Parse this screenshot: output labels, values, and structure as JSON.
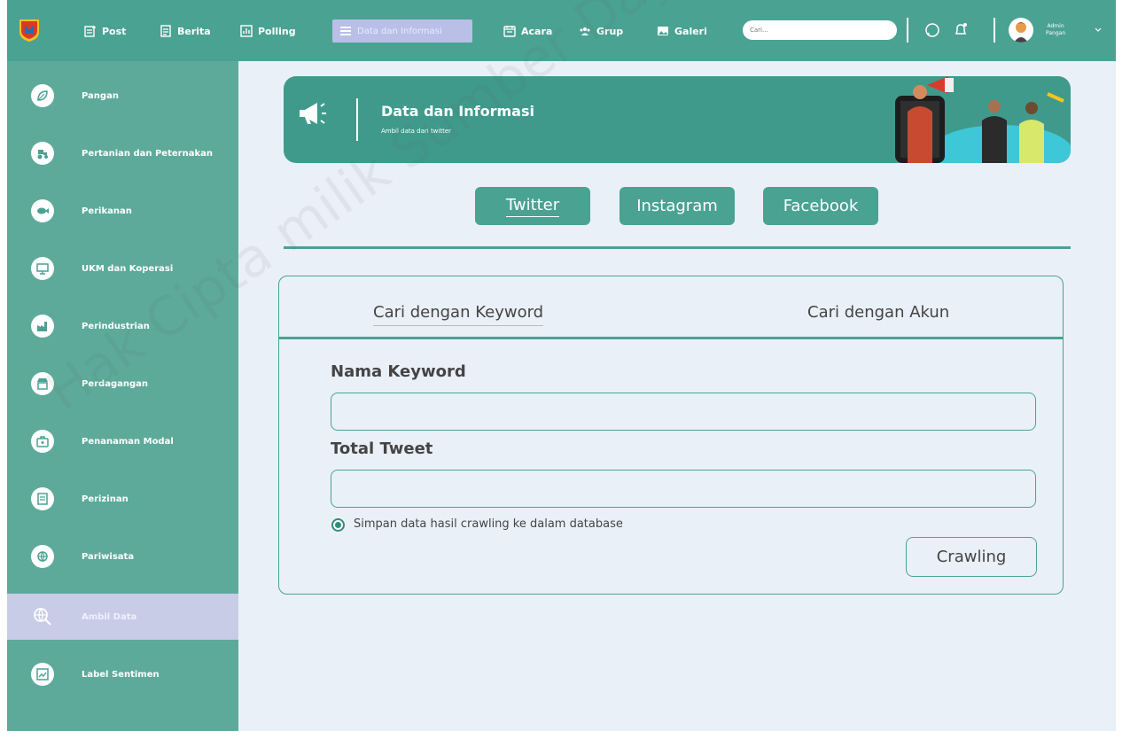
{
  "topbar": {
    "nav": [
      {
        "label": "Post",
        "icon": "post-icon"
      },
      {
        "label": "Berita",
        "icon": "news-icon"
      },
      {
        "label": "Polling",
        "icon": "chart-icon"
      },
      {
        "label": "Data dan Informasi",
        "icon": "list-icon",
        "active": true
      },
      {
        "label": "Acara",
        "icon": "calendar-icon"
      },
      {
        "label": "Grup",
        "icon": "group-icon"
      },
      {
        "label": "Galeri",
        "icon": "image-icon"
      }
    ],
    "search_placeholder": "Cari...",
    "user_name": "Admin",
    "user_role": "Pangan"
  },
  "sidebar": {
    "items": [
      {
        "label": "Pangan"
      },
      {
        "label": "Pertanian dan Peternakan"
      },
      {
        "label": "Perikanan"
      },
      {
        "label": "UKM dan Koperasi"
      },
      {
        "label": "Perindustrian"
      },
      {
        "label": "Perdagangan"
      },
      {
        "label": "Penanaman Modal"
      },
      {
        "label": "Perizinan"
      },
      {
        "label": "Pariwisata"
      },
      {
        "label": "Ambil Data",
        "active": true
      },
      {
        "label": "Label Sentimen"
      }
    ]
  },
  "banner": {
    "title": "Data dan Informasi",
    "subtitle": "Ambil data dari twitter"
  },
  "social_tabs": [
    {
      "label": "Twitter",
      "active": true
    },
    {
      "label": "Instagram"
    },
    {
      "label": "Facebook"
    }
  ],
  "form": {
    "tab_keyword": "Cari dengan Keyword",
    "tab_account": "Cari dengan Akun",
    "keyword_label": "Nama Keyword",
    "keyword_value": "",
    "tweet_label": "Total Tweet",
    "tweet_value": "",
    "save_label": "Simpan data hasil crawling ke dalam database",
    "save_checked": true,
    "button_label": "Crawling"
  },
  "watermark": "Hak Cipta milik Sumber Daya Alam & Investasi BAPPEDA",
  "colors": {
    "primary": "#4aa293",
    "background": "#eaf0f8",
    "active_nav": "#b9bfe6",
    "sidebar_active": "#c9cce7"
  }
}
